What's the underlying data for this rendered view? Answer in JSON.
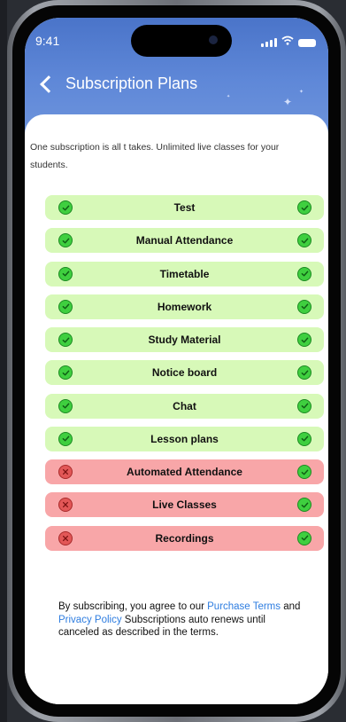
{
  "status_bar": {
    "time": "9:41"
  },
  "header": {
    "title": "Subscription Plans"
  },
  "intro_text": "One subscription is all t takes. Unlimited live classes for your students.",
  "features": [
    {
      "label": "Test",
      "included": true
    },
    {
      "label": "Manual Attendance",
      "included": true
    },
    {
      "label": "Timetable",
      "included": true
    },
    {
      "label": "Homework",
      "included": true
    },
    {
      "label": "Study Material",
      "included": true
    },
    {
      "label": "Notice board",
      "included": true
    },
    {
      "label": "Chat",
      "included": true
    },
    {
      "label": "Lesson plans",
      "included": true
    },
    {
      "label": "Automated Attendance",
      "included": false
    },
    {
      "label": "Live Classes",
      "included": false
    },
    {
      "label": "Recordings",
      "included": false
    }
  ],
  "terms": {
    "part1": "By subscribing, you agree to our ",
    "purchase_link": "Purchase Terms",
    "part2": " and ",
    "privacy_link": "Privacy Policy",
    "part3": " Subscriptions auto renews until canceled as described in the terms."
  },
  "colors": {
    "header": "#5f88d8",
    "included_row": "#d7f9b8",
    "excluded_row": "#f8a6a8",
    "check": "#3fcf3f",
    "cross": "#e25757",
    "link": "#2e7de0"
  }
}
